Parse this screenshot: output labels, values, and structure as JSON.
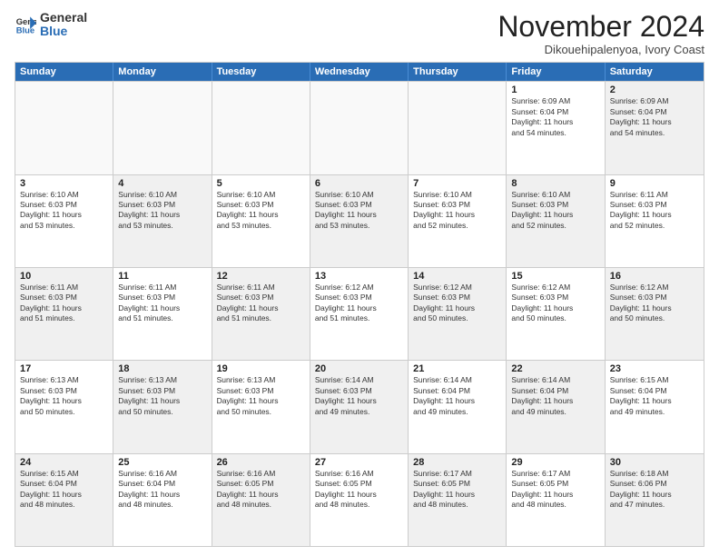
{
  "logo": {
    "general": "General",
    "blue": "Blue"
  },
  "title": "November 2024",
  "location": "Dikouehipalenyoa, Ivory Coast",
  "days": [
    "Sunday",
    "Monday",
    "Tuesday",
    "Wednesday",
    "Thursday",
    "Friday",
    "Saturday"
  ],
  "rows": [
    [
      {
        "day": "",
        "empty": true
      },
      {
        "day": "",
        "empty": true
      },
      {
        "day": "",
        "empty": true
      },
      {
        "day": "",
        "empty": true
      },
      {
        "day": "",
        "empty": true
      },
      {
        "day": "1",
        "lines": [
          "Sunrise: 6:09 AM",
          "Sunset: 6:04 PM",
          "Daylight: 11 hours",
          "and 54 minutes."
        ]
      },
      {
        "day": "2",
        "shaded": true,
        "lines": [
          "Sunrise: 6:09 AM",
          "Sunset: 6:04 PM",
          "Daylight: 11 hours",
          "and 54 minutes."
        ]
      }
    ],
    [
      {
        "day": "3",
        "lines": [
          "Sunrise: 6:10 AM",
          "Sunset: 6:03 PM",
          "Daylight: 11 hours",
          "and 53 minutes."
        ]
      },
      {
        "day": "4",
        "shaded": true,
        "lines": [
          "Sunrise: 6:10 AM",
          "Sunset: 6:03 PM",
          "Daylight: 11 hours",
          "and 53 minutes."
        ]
      },
      {
        "day": "5",
        "lines": [
          "Sunrise: 6:10 AM",
          "Sunset: 6:03 PM",
          "Daylight: 11 hours",
          "and 53 minutes."
        ]
      },
      {
        "day": "6",
        "shaded": true,
        "lines": [
          "Sunrise: 6:10 AM",
          "Sunset: 6:03 PM",
          "Daylight: 11 hours",
          "and 53 minutes."
        ]
      },
      {
        "day": "7",
        "lines": [
          "Sunrise: 6:10 AM",
          "Sunset: 6:03 PM",
          "Daylight: 11 hours",
          "and 52 minutes."
        ]
      },
      {
        "day": "8",
        "shaded": true,
        "lines": [
          "Sunrise: 6:10 AM",
          "Sunset: 6:03 PM",
          "Daylight: 11 hours",
          "and 52 minutes."
        ]
      },
      {
        "day": "9",
        "lines": [
          "Sunrise: 6:11 AM",
          "Sunset: 6:03 PM",
          "Daylight: 11 hours",
          "and 52 minutes."
        ]
      }
    ],
    [
      {
        "day": "10",
        "shaded": true,
        "lines": [
          "Sunrise: 6:11 AM",
          "Sunset: 6:03 PM",
          "Daylight: 11 hours",
          "and 51 minutes."
        ]
      },
      {
        "day": "11",
        "lines": [
          "Sunrise: 6:11 AM",
          "Sunset: 6:03 PM",
          "Daylight: 11 hours",
          "and 51 minutes."
        ]
      },
      {
        "day": "12",
        "shaded": true,
        "lines": [
          "Sunrise: 6:11 AM",
          "Sunset: 6:03 PM",
          "Daylight: 11 hours",
          "and 51 minutes."
        ]
      },
      {
        "day": "13",
        "lines": [
          "Sunrise: 6:12 AM",
          "Sunset: 6:03 PM",
          "Daylight: 11 hours",
          "and 51 minutes."
        ]
      },
      {
        "day": "14",
        "shaded": true,
        "lines": [
          "Sunrise: 6:12 AM",
          "Sunset: 6:03 PM",
          "Daylight: 11 hours",
          "and 50 minutes."
        ]
      },
      {
        "day": "15",
        "lines": [
          "Sunrise: 6:12 AM",
          "Sunset: 6:03 PM",
          "Daylight: 11 hours",
          "and 50 minutes."
        ]
      },
      {
        "day": "16",
        "shaded": true,
        "lines": [
          "Sunrise: 6:12 AM",
          "Sunset: 6:03 PM",
          "Daylight: 11 hours",
          "and 50 minutes."
        ]
      }
    ],
    [
      {
        "day": "17",
        "lines": [
          "Sunrise: 6:13 AM",
          "Sunset: 6:03 PM",
          "Daylight: 11 hours",
          "and 50 minutes."
        ]
      },
      {
        "day": "18",
        "shaded": true,
        "lines": [
          "Sunrise: 6:13 AM",
          "Sunset: 6:03 PM",
          "Daylight: 11 hours",
          "and 50 minutes."
        ]
      },
      {
        "day": "19",
        "lines": [
          "Sunrise: 6:13 AM",
          "Sunset: 6:03 PM",
          "Daylight: 11 hours",
          "and 50 minutes."
        ]
      },
      {
        "day": "20",
        "shaded": true,
        "lines": [
          "Sunrise: 6:14 AM",
          "Sunset: 6:03 PM",
          "Daylight: 11 hours",
          "and 49 minutes."
        ]
      },
      {
        "day": "21",
        "lines": [
          "Sunrise: 6:14 AM",
          "Sunset: 6:04 PM",
          "Daylight: 11 hours",
          "and 49 minutes."
        ]
      },
      {
        "day": "22",
        "shaded": true,
        "lines": [
          "Sunrise: 6:14 AM",
          "Sunset: 6:04 PM",
          "Daylight: 11 hours",
          "and 49 minutes."
        ]
      },
      {
        "day": "23",
        "lines": [
          "Sunrise: 6:15 AM",
          "Sunset: 6:04 PM",
          "Daylight: 11 hours",
          "and 49 minutes."
        ]
      }
    ],
    [
      {
        "day": "24",
        "shaded": true,
        "lines": [
          "Sunrise: 6:15 AM",
          "Sunset: 6:04 PM",
          "Daylight: 11 hours",
          "and 48 minutes."
        ]
      },
      {
        "day": "25",
        "lines": [
          "Sunrise: 6:16 AM",
          "Sunset: 6:04 PM",
          "Daylight: 11 hours",
          "and 48 minutes."
        ]
      },
      {
        "day": "26",
        "shaded": true,
        "lines": [
          "Sunrise: 6:16 AM",
          "Sunset: 6:05 PM",
          "Daylight: 11 hours",
          "and 48 minutes."
        ]
      },
      {
        "day": "27",
        "lines": [
          "Sunrise: 6:16 AM",
          "Sunset: 6:05 PM",
          "Daylight: 11 hours",
          "and 48 minutes."
        ]
      },
      {
        "day": "28",
        "shaded": true,
        "lines": [
          "Sunrise: 6:17 AM",
          "Sunset: 6:05 PM",
          "Daylight: 11 hours",
          "and 48 minutes."
        ]
      },
      {
        "day": "29",
        "lines": [
          "Sunrise: 6:17 AM",
          "Sunset: 6:05 PM",
          "Daylight: 11 hours",
          "and 48 minutes."
        ]
      },
      {
        "day": "30",
        "shaded": true,
        "lines": [
          "Sunrise: 6:18 AM",
          "Sunset: 6:06 PM",
          "Daylight: 11 hours",
          "and 47 minutes."
        ]
      }
    ]
  ]
}
